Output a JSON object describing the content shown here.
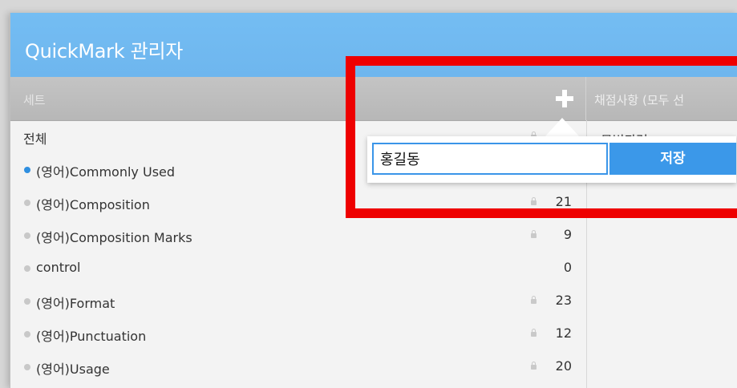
{
  "window": {
    "title": "QuickMark 관리자"
  },
  "header": {
    "sets_label": "세트",
    "items_label": "채점사항 (모두 선"
  },
  "sets": [
    {
      "label": "전체",
      "dot": "none",
      "locked": true,
      "count": ""
    },
    {
      "label": "(영어)Commonly Used",
      "dot": "active",
      "locked": false,
      "count": ""
    },
    {
      "label": "(영어)Composition",
      "dot": "inactive",
      "locked": true,
      "count": "21"
    },
    {
      "label": "(영어)Composition Marks",
      "dot": "inactive",
      "locked": true,
      "count": "9"
    },
    {
      "label": "control",
      "dot": "inactive",
      "locked": false,
      "count": "0"
    },
    {
      "label": "(영어)Format",
      "dot": "inactive",
      "locked": true,
      "count": "23"
    },
    {
      "label": "(영어)Punctuation",
      "dot": "inactive",
      "locked": true,
      "count": "12"
    },
    {
      "label": "(영어)Usage",
      "dot": "inactive",
      "locked": true,
      "count": "20"
    }
  ],
  "items": [
    {
      "label": "문법관련"
    }
  ],
  "new_set_popup": {
    "input_value": "홍길동",
    "save_label": "저장"
  },
  "highlight": {
    "color": "#ee0000"
  },
  "colors": {
    "titlebar": "#6eb6ee",
    "accent": "#3b98e9",
    "header": "#b7b7b7"
  },
  "icons": {
    "add": "plus-icon",
    "lock": "lock-icon",
    "bullet": "dot-icon"
  }
}
